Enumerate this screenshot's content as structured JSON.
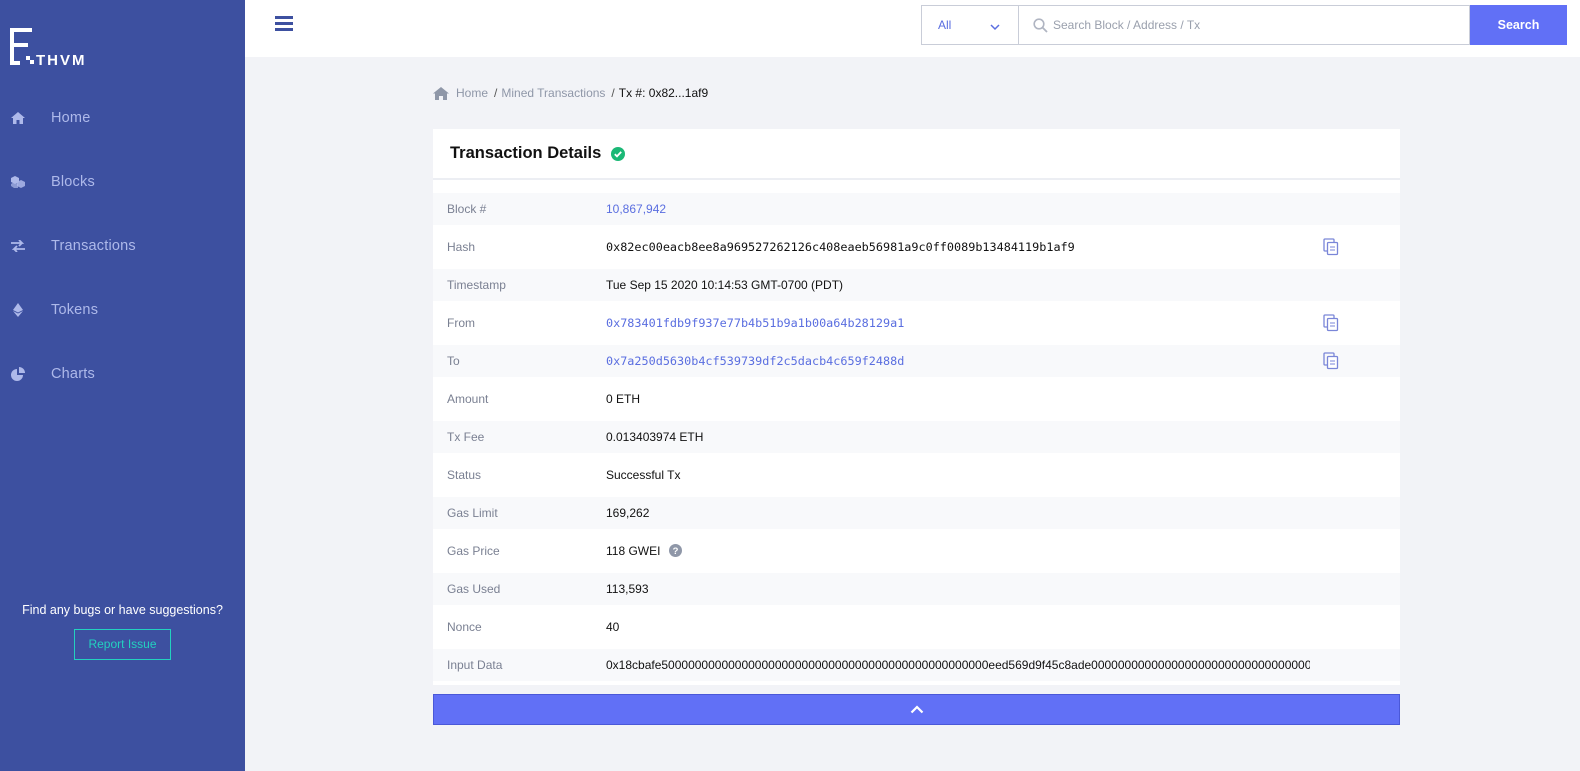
{
  "sidebar": {
    "logo_text": "ETHVM",
    "items": [
      {
        "label": "Home",
        "icon": "home-icon"
      },
      {
        "label": "Blocks",
        "icon": "blocks-icon"
      },
      {
        "label": "Transactions",
        "icon": "transfer-icon"
      },
      {
        "label": "Tokens",
        "icon": "ethereum-icon"
      },
      {
        "label": "Charts",
        "icon": "pie-chart-icon"
      }
    ],
    "feedback_text": "Find any bugs or have suggestions?",
    "report_label": "Report Issue"
  },
  "topbar": {
    "menu_icon": "hamburger-icon",
    "filter_selected": "All",
    "search_placeholder": "Search Block / Address / Tx",
    "search_value": "",
    "search_label": "Search"
  },
  "breadcrumb": {
    "home": "Home",
    "sep1": "/",
    "mined": "Mined Transactions",
    "sep2": "/",
    "current": "Tx #: 0x82...1af9"
  },
  "details": {
    "title": "Transaction Details",
    "status_icon": "check-circle-icon",
    "rows": [
      {
        "key": "Block #",
        "value": "10,867,942"
      },
      {
        "key": "Hash",
        "value": "0x82ec00eacb8ee8a969527262126c408eaeb56981a9c0ff0089b13484119b1af9"
      },
      {
        "key": "Timestamp",
        "value": "Tue Sep 15 2020 10:14:53 GMT-0700 (PDT)"
      },
      {
        "key": "From",
        "value": "0x783401fdb9f937e77b4b51b9a1b00a64b28129a1"
      },
      {
        "key": "To",
        "value": "0x7a250d5630b4cf539739df2c5dacb4c659f2488d"
      },
      {
        "key": "Amount",
        "value": "0 ETH"
      },
      {
        "key": "Tx Fee",
        "value": "0.013403974 ETH"
      },
      {
        "key": "Status",
        "value": "Successful Tx"
      },
      {
        "key": "Gas Limit",
        "value": "169,262"
      },
      {
        "key": "Gas Price",
        "value": "118 GWEI"
      },
      {
        "key": "Gas Used",
        "value": "113,593"
      },
      {
        "key": "Nonce",
        "value": "40"
      },
      {
        "key": "Input Data",
        "value": "0x18cbafe5000000000000000000000000000000000000000000000000eed569d9f45c8ade0000000000000000000000000000000000000000000000000"
      }
    ]
  },
  "colors": {
    "sidebar_bg": "#3d50a0",
    "accent": "#6170f6",
    "link": "#5a6ee0",
    "success": "#1bb876",
    "report_border": "#23d1bf"
  }
}
